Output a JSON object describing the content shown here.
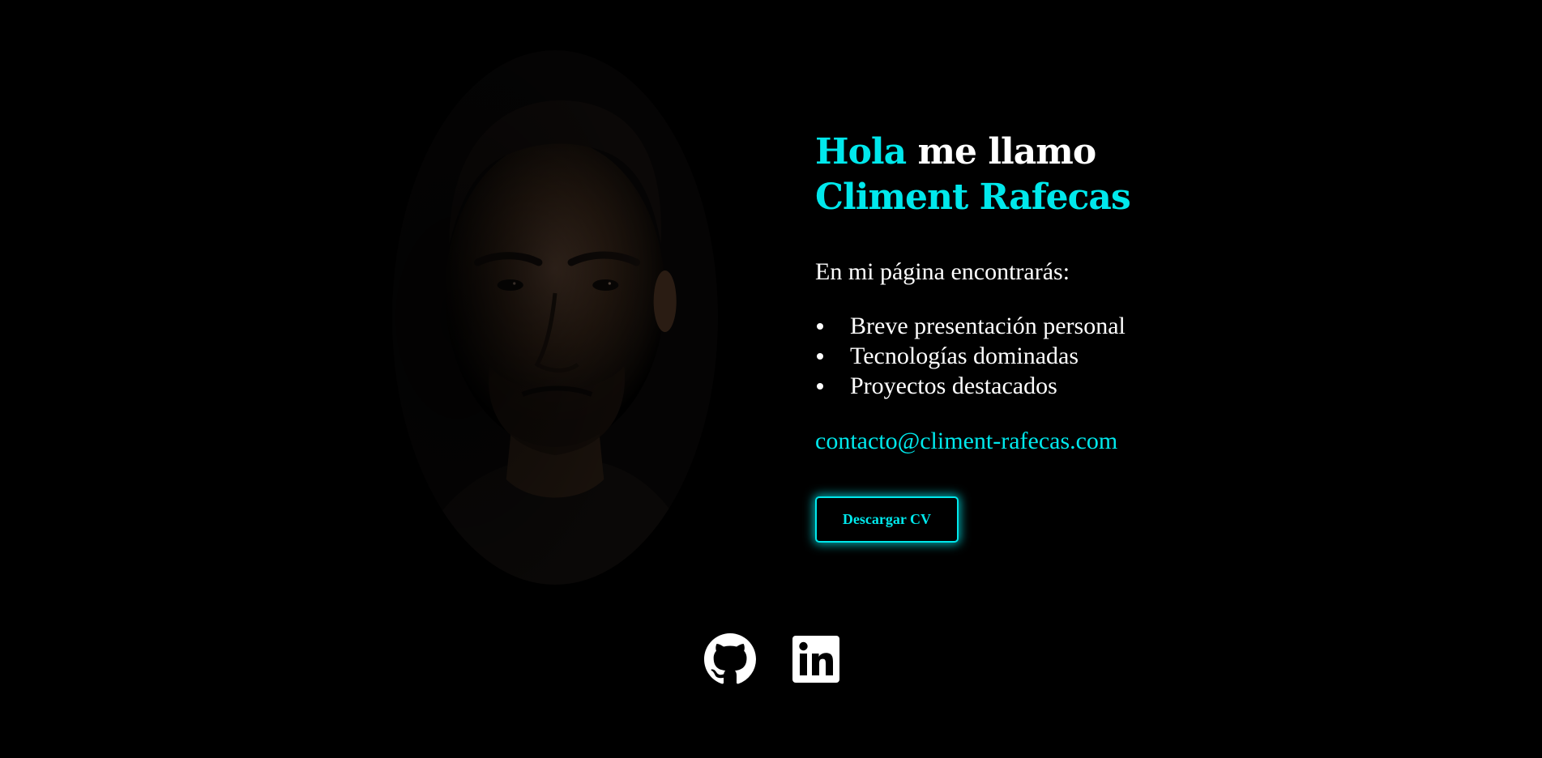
{
  "hero": {
    "greeting_accent": "Hola",
    "greeting_rest": " me llamo",
    "name": "Climent Rafecas",
    "intro": "En mi página encontrarás:",
    "features": [
      "Breve presentación personal",
      "Tecnologías dominadas",
      "Proyectos destacados"
    ],
    "email": "contacto@climent-rafecas.com",
    "cv_button_label": "Descargar CV"
  },
  "social": {
    "icons": [
      "github-icon",
      "linkedin-icon"
    ]
  },
  "colors": {
    "background": "#000000",
    "accent": "#00e8ec",
    "text": "#ffffff"
  }
}
